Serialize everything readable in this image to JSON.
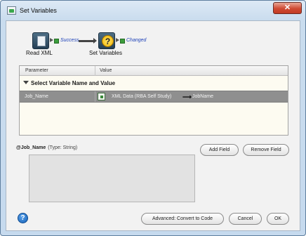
{
  "window": {
    "title": "Set Variables",
    "close_label": "✕"
  },
  "workflow": {
    "step1_label": "Read XML",
    "step1_condition": "Success",
    "step2_label": "Set Variables",
    "step2_condition": "Changed"
  },
  "table": {
    "col_parameter": "Parameter",
    "col_value": "Value",
    "group_label": "Select Variable Name and Value",
    "rows": [
      {
        "parameter": "Job_Name",
        "value_source": "XML Data (RBA Self Study)",
        "value_target": "JobName"
      }
    ]
  },
  "variable": {
    "name": "@Job_Name",
    "type": "(Type: String)"
  },
  "buttons": {
    "add_field": "Add Field",
    "remove_field": "Remove Field",
    "advanced": "Advanced: Convert to Code",
    "cancel": "Cancel",
    "ok": "OK",
    "help": "?"
  },
  "colors": {
    "selected_row": "#8f8f8f",
    "condition_text": "#1a3fb8",
    "close_button": "#cf4a33"
  }
}
